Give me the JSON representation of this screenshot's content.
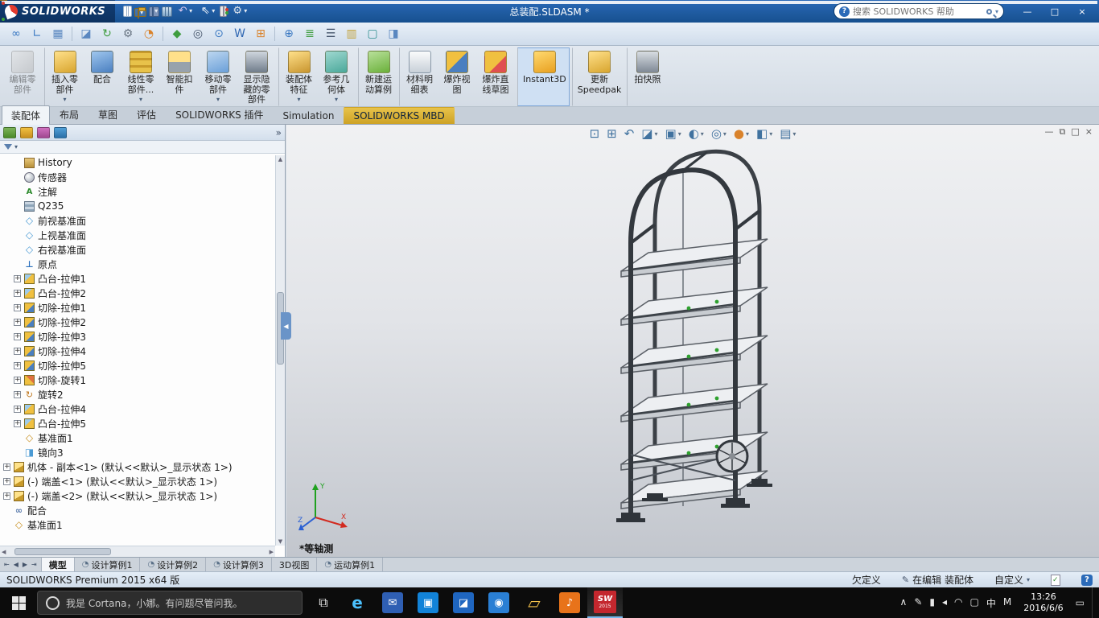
{
  "ui": {
    "caret_glyph": "▾",
    "help_glyph": "?"
  },
  "title_bar": {
    "app_name": "SOLIDWORKS",
    "document_title": "总装配.SLDASM *",
    "search": {
      "placeholder": "搜索 SOLIDWORKS 帮助"
    },
    "quick_icons": [
      {
        "name": "new-document-icon",
        "cls": "ti-new"
      },
      {
        "name": "open-document-icon",
        "cls": "ti-open",
        "caret": true
      },
      {
        "name": "save-icon",
        "cls": "ti-save",
        "caret": true
      },
      {
        "name": "print-icon",
        "cls": "ti-print"
      },
      {
        "name": "undo-icon",
        "cls": "ti-undo",
        "glyph": "↶",
        "caret": true
      },
      {
        "name": "select-icon",
        "cls": "ti-select",
        "glyph": "⇖",
        "caret": true
      },
      {
        "name": "rebuild-icon",
        "cls": "ti-rebuild"
      },
      {
        "name": "options-icon",
        "cls": "ti-options",
        "glyph": "⚙",
        "caret": true
      }
    ],
    "window_controls": [
      {
        "name": "minimize-button",
        "glyph": "—"
      },
      {
        "name": "maximize-button",
        "glyph": "□"
      },
      {
        "name": "close-button",
        "glyph": "×"
      }
    ]
  },
  "quickbar_icons": [
    {
      "name": "mate-reference-icon",
      "glyph": "∞",
      "color": "#3a78c2"
    },
    {
      "name": "measure-icon",
      "glyph": "∟",
      "color": "#3a78c2"
    },
    {
      "name": "mass-properties-icon",
      "glyph": "▦",
      "color": "#5a87c0",
      "cls": "sep-after"
    },
    {
      "name": "section-properties-icon",
      "glyph": "◪",
      "color": "#5a87c0"
    },
    {
      "name": "motion-icon",
      "glyph": "↻",
      "color": "#3f9d3f"
    },
    {
      "name": "options-gear-icon",
      "glyph": "⚙",
      "color": "#6a7684"
    },
    {
      "name": "appearance-icon",
      "glyph": "◔",
      "color": "#d9822b",
      "cls": "sep-after"
    },
    {
      "name": "verification-icon",
      "glyph": "◆",
      "color": "#3f9d3f"
    },
    {
      "name": "visibility-eye-icon",
      "glyph": "◎",
      "color": "#44536a"
    },
    {
      "name": "magnifier-icon",
      "glyph": "⊙",
      "color": "#3a78c2"
    },
    {
      "name": "toolbox-icon",
      "glyph": "W",
      "color": "#2f66b2"
    },
    {
      "name": "grid-icon",
      "glyph": "⊞",
      "color": "#d9822b",
      "cls": "sep-after"
    },
    {
      "name": "zoom-icon",
      "glyph": "⊕",
      "color": "#3a78c2"
    },
    {
      "name": "document-list-icon",
      "glyph": "≣",
      "color": "#3f9d3f"
    },
    {
      "name": "print-small-icon",
      "glyph": "☰",
      "color": "#44536a"
    },
    {
      "name": "chart-icon",
      "glyph": "▥",
      "color": "#c2a23a"
    },
    {
      "name": "screen-icon",
      "glyph": "▢",
      "color": "#2f8f8f"
    },
    {
      "name": "task-pane-icon",
      "glyph": "◨",
      "color": "#5a87c0"
    }
  ],
  "ribbon": {
    "buttons": [
      {
        "label": "编辑零\n部件",
        "icon": "edit",
        "disabled": true
      },
      {
        "label": "插入零\n部件",
        "icon": "insert",
        "caret": true,
        "cls": "group-start"
      },
      {
        "label": "配合",
        "icon": "mate"
      },
      {
        "label": "线性零\n部件...",
        "icon": "pattern",
        "caret": true
      },
      {
        "label": "智能扣\n件",
        "icon": "fastener"
      },
      {
        "label": "移动零\n部件",
        "icon": "move",
        "caret": true
      },
      {
        "label": "显示隐\n藏的零\n部件",
        "icon": "showhide"
      },
      {
        "label": "装配体\n特征",
        "icon": "asmfeat",
        "caret": true,
        "cls": "group-start"
      },
      {
        "label": "参考几\n何体",
        "icon": "refgeo",
        "caret": true
      },
      {
        "label": "新建运\n动算例",
        "icon": "motion",
        "cls": "group-start"
      },
      {
        "label": "材料明\n细表",
        "icon": "bom",
        "cls": "group-start"
      },
      {
        "label": "爆炸视\n图",
        "icon": "explode"
      },
      {
        "label": "爆炸直\n线草图",
        "icon": "explodesketch"
      },
      {
        "label": "Instant3D",
        "icon": "instant3d",
        "active": true,
        "cls": "group-start"
      },
      {
        "label": "更新\nSpeedpak",
        "icon": "speedpak",
        "cls": "group-start"
      },
      {
        "label": "拍快照",
        "icon": "snapshot",
        "cls": "group-start"
      }
    ],
    "tabs": [
      {
        "label": "装配体",
        "active": true
      },
      {
        "label": "布局"
      },
      {
        "label": "草图"
      },
      {
        "label": "评估"
      },
      {
        "label": "SOLIDWORKS 插件"
      },
      {
        "label": "Simulation"
      },
      {
        "label": "SOLIDWORKS MBD",
        "cls": "gold"
      }
    ]
  },
  "left_panel": {
    "tabs": [
      {
        "name": "featuremanager-tab-icon",
        "cls": "pt-fm"
      },
      {
        "name": "propertymanager-tab-icon",
        "cls": "pt-pm"
      },
      {
        "name": "configurationmanager-tab-icon",
        "cls": "pt-cm"
      },
      {
        "name": "displaymanager-tab-icon",
        "cls": "pt-dm"
      }
    ],
    "expand_glyph": "»",
    "collapse_glyph": "◀"
  },
  "feature_tree": {
    "expand_glyph": "+",
    "items": [
      {
        "label": "History",
        "icon": "history",
        "level": 1
      },
      {
        "label": "传感器",
        "icon": "sensor",
        "level": 1
      },
      {
        "label": "注解",
        "icon": "annotations",
        "level": 1
      },
      {
        "label": "Q235",
        "icon": "material",
        "level": 1
      },
      {
        "label": "前视基准面",
        "icon": "plane",
        "level": 1
      },
      {
        "label": "上视基准面",
        "icon": "plane",
        "level": 1
      },
      {
        "label": "右视基准面",
        "icon": "plane",
        "level": 1
      },
      {
        "label": "原点",
        "icon": "origin",
        "level": 1
      },
      {
        "label": "凸台-拉伸1",
        "icon": "boss",
        "level": 1,
        "expandable": true
      },
      {
        "label": "凸台-拉伸2",
        "icon": "boss",
        "level": 1,
        "expandable": true
      },
      {
        "label": "切除-拉伸1",
        "icon": "cut",
        "level": 1,
        "expandable": true
      },
      {
        "label": "切除-拉伸2",
        "icon": "cut",
        "level": 1,
        "expandable": true
      },
      {
        "label": "切除-拉伸3",
        "icon": "cut",
        "level": 1,
        "expandable": true
      },
      {
        "label": "切除-拉伸4",
        "icon": "cut",
        "level": 1,
        "expandable": true
      },
      {
        "label": "切除-拉伸5",
        "icon": "cut",
        "level": 1,
        "expandable": true
      },
      {
        "label": "切除-旋转1",
        "icon": "cut-revolve",
        "level": 1,
        "expandable": true
      },
      {
        "label": "旋转2",
        "icon": "revolve",
        "level": 1,
        "expandable": true
      },
      {
        "label": "凸台-拉伸4",
        "icon": "boss",
        "level": 1,
        "expandable": true
      },
      {
        "label": "凸台-拉伸5",
        "icon": "boss",
        "level": 1,
        "expandable": true
      },
      {
        "label": "基准面1",
        "icon": "plane-ref",
        "level": 1
      },
      {
        "label": "镜向3",
        "icon": "mirror",
        "level": 1
      },
      {
        "label": "机体 - 副本<1> (默认<<默认>_显示状态 1>)",
        "icon": "part",
        "level": 0,
        "expandable": true
      },
      {
        "label": "(-) 端盖<1> (默认<<默认>_显示状态 1>)",
        "icon": "part",
        "level": 0,
        "expandable": true
      },
      {
        "label": "(-) 端盖<2> (默认<<默认>_显示状态 1>)",
        "icon": "part",
        "level": 0,
        "expandable": true
      },
      {
        "label": "配合",
        "icon": "mates",
        "level": 0
      },
      {
        "label": "基准面1",
        "icon": "plane-ref",
        "level": 0
      }
    ]
  },
  "viewport": {
    "view_label": "*等轴测",
    "triad": {
      "x": "X",
      "y": "Y",
      "z": "Z"
    },
    "hud_icons": [
      {
        "name": "zoom-fit-icon",
        "glyph": "⊡"
      },
      {
        "name": "zoom-area-icon",
        "glyph": "⊞"
      },
      {
        "name": "previous-view-icon",
        "glyph": "↶"
      },
      {
        "name": "section-view-icon",
        "glyph": "◪",
        "caret": true
      },
      {
        "name": "view-orientation-icon",
        "glyph": "▣",
        "caret": true
      },
      {
        "name": "display-style-icon",
        "glyph": "◐",
        "caret": true
      },
      {
        "name": "hide-show-items-icon",
        "glyph": "◎",
        "caret": true
      },
      {
        "name": "edit-appearance-icon",
        "glyph": "●",
        "color": "#d9822b",
        "caret": true
      },
      {
        "name": "apply-scene-icon",
        "glyph": "◧",
        "caret": true
      },
      {
        "name": "view-settings-icon",
        "glyph": "▤",
        "caret": true
      }
    ],
    "corner_icons": [
      {
        "name": "viewport-minimize-icon",
        "glyph": "—"
      },
      {
        "name": "viewport-restore-icon",
        "glyph": "⧉"
      },
      {
        "name": "viewport-maximize-icon",
        "glyph": "□"
      },
      {
        "name": "viewport-close-icon",
        "glyph": "×"
      }
    ]
  },
  "doc_tabs": {
    "nav": [
      {
        "name": "first-tab-button",
        "glyph": "⇤"
      },
      {
        "name": "prev-tab-button",
        "glyph": "◀"
      },
      {
        "name": "next-tab-button",
        "glyph": "▶"
      },
      {
        "name": "last-tab-button",
        "glyph": "⇥"
      }
    ],
    "tabs": [
      {
        "label": "模型",
        "active": true
      },
      {
        "label": "设计算例1",
        "study_icon": true
      },
      {
        "label": "设计算例2",
        "study_icon": true
      },
      {
        "label": "设计算例3",
        "study_icon": true
      },
      {
        "label": "3D视图"
      },
      {
        "label": "运动算例1",
        "study_icon": true
      }
    ],
    "study_icon_glyph": "◔"
  },
  "status_bar": {
    "left": "SOLIDWORKS Premium 2015 x64 版",
    "underdefined": "欠定义",
    "editing": "在编辑 装配体",
    "custom": "自定义",
    "edit_glyph": "✎"
  },
  "taskbar": {
    "cortana_text": "我是 Cortana，小娜。有问题尽管问我。",
    "taskview_glyph": "⧉",
    "icons": [
      {
        "name": "edge-icon",
        "cls": "tk-edge",
        "glyph": "e",
        "color": "#4cc2ff"
      },
      {
        "name": "mail-icon",
        "tile": "#2f5fb3",
        "glyph": "✉"
      },
      {
        "name": "store-icon",
        "tile": "#1283d8",
        "glyph": "▣"
      },
      {
        "name": "photos-icon",
        "tile": "#1f66c0",
        "glyph": "◪"
      },
      {
        "name": "browser-icon",
        "tile": "#2a7fd4",
        "glyph": "◉"
      },
      {
        "name": "file-explorer-icon",
        "cls": "tk-folder",
        "glyph": "▱",
        "color": "#f4c24b"
      },
      {
        "name": "media-player-icon",
        "tile": "#e8731a",
        "glyph": "♪"
      }
    ],
    "solidworks": {
      "line1": "SW",
      "line2": "2015"
    },
    "tray": [
      {
        "name": "tray-expand-icon",
        "glyph": "∧"
      },
      {
        "name": "pen-input-icon",
        "glyph": "✎"
      },
      {
        "name": "battery-icon",
        "glyph": "▮"
      },
      {
        "name": "volume-icon",
        "glyph": "◂"
      },
      {
        "name": "network-icon",
        "glyph": "◠"
      },
      {
        "name": "display-icon",
        "glyph": "▢"
      },
      {
        "name": "ime-language-indicator",
        "glyph": "中"
      },
      {
        "name": "ime-mode-indicator",
        "glyph": "M"
      }
    ],
    "clock": {
      "time": "13:26",
      "date": "2016/6/6"
    },
    "action_center_glyph": "▭"
  }
}
